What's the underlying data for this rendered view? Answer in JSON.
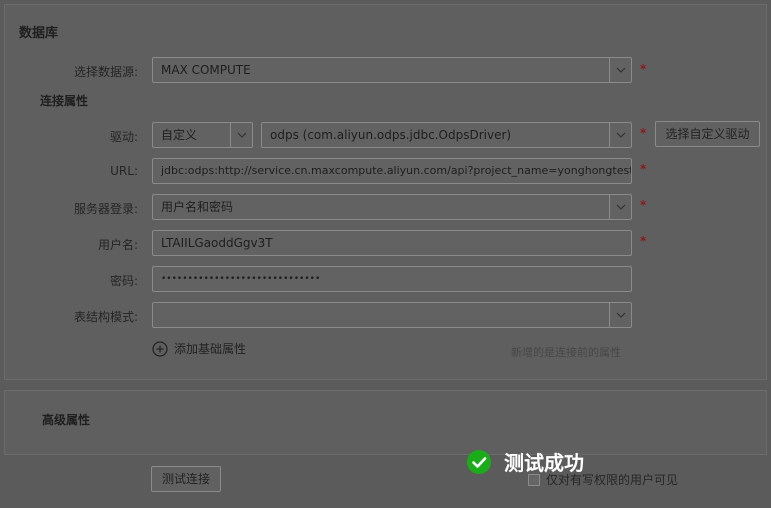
{
  "section_database": {
    "title": "数据库"
  },
  "datasource": {
    "label": "选择数据源:",
    "value": "MAX COMPUTE",
    "required": "*"
  },
  "connection": {
    "title": "连接属性"
  },
  "driver": {
    "label": "驱动:",
    "type_value": "自定义",
    "driver_value": "odps (com.aliyun.odps.jdbc.OdpsDriver)",
    "required": "*",
    "custom_button": "选择自定义驱动"
  },
  "url": {
    "label": "URL:",
    "value": "jdbc:odps:http://service.cn.maxcompute.aliyun.com/api?project_name=yonghongtest",
    "required": "*"
  },
  "server_login": {
    "label": "服务器登录:",
    "value": "用户名和密码",
    "required": "*"
  },
  "username": {
    "label": "用户名:",
    "value": "LTAIILGaoddGgv3T",
    "required": "*"
  },
  "password": {
    "label": "密码:",
    "value": "••••••••••••••••••••••••••••••"
  },
  "schema": {
    "label": "表结构模式:",
    "value": ""
  },
  "add_attr": {
    "label": "添加基础属性"
  },
  "hint": "新增的是连接前的属性",
  "advanced": {
    "title": "高级属性"
  },
  "test_button": "测试连接",
  "visibility": {
    "label": "仅对有写权限的用户可见"
  },
  "toast": {
    "message": "测试成功",
    "color": "#1aad19"
  }
}
